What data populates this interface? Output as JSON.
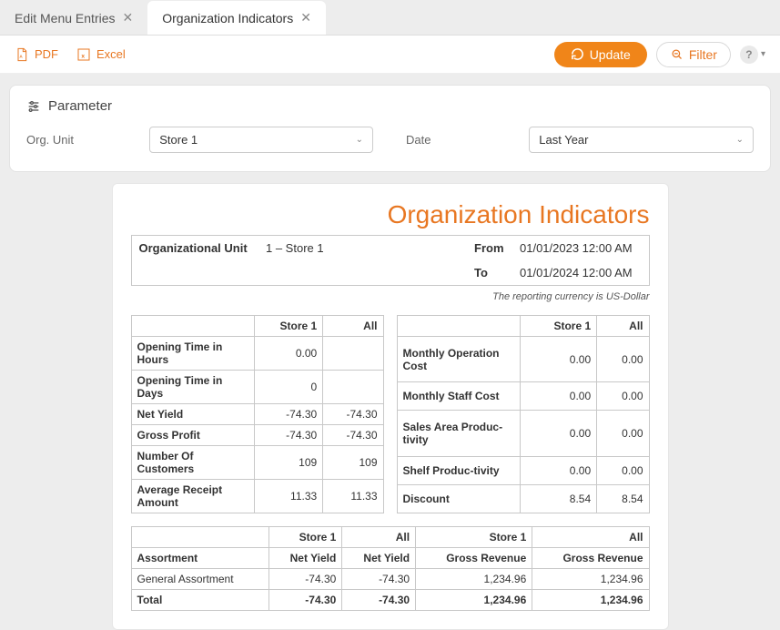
{
  "tabs": [
    {
      "label": "Edit Menu Entries",
      "active": false
    },
    {
      "label": "Organization Indicators",
      "active": true
    }
  ],
  "toolbar": {
    "pdf": "PDF",
    "excel": "Excel",
    "update": "Update",
    "filter": "Filter"
  },
  "parameter": {
    "heading": "Parameter",
    "orgunit_label": "Org. Unit",
    "orgunit_value": "Store 1",
    "date_label": "Date",
    "date_value": "Last Year"
  },
  "report": {
    "title": "Organization Indicators",
    "orgunit_label": "Organizational Unit",
    "orgunit_value": "1 – Store 1",
    "from_label": "From",
    "from_value": "01/01/2023 12:00 AM",
    "to_label": "To",
    "to_value": "01/01/2024 12:00 AM",
    "currency_note": "The reporting currency is US-Dollar",
    "col_store": "Store 1",
    "col_all": "All",
    "left_rows": [
      {
        "label": "Opening Time in Hours",
        "store": "0.00",
        "all": ""
      },
      {
        "label": "Opening Time in Days",
        "store": "0",
        "all": ""
      },
      {
        "label": "Net Yield",
        "store": "-74.30",
        "all": "-74.30"
      },
      {
        "label": "Gross Profit",
        "store": "-74.30",
        "all": "-74.30"
      },
      {
        "label": "Number Of Customers",
        "store": "109",
        "all": "109"
      },
      {
        "label": "Average Receipt Amount",
        "store": "11.33",
        "all": "11.33"
      }
    ],
    "right_rows": [
      {
        "label": "Monthly Operation Cost",
        "store": "0.00",
        "all": "0.00"
      },
      {
        "label": "Monthly Staff Cost",
        "store": "0.00",
        "all": "0.00"
      },
      {
        "label": "Sales Area Produc-tivity",
        "store": "0.00",
        "all": "0.00"
      },
      {
        "label": "Shelf Produc-tivity",
        "store": "0.00",
        "all": "0.00"
      },
      {
        "label": "Discount",
        "store": "8.54",
        "all": "8.54"
      }
    ],
    "wide": {
      "header1": {
        "c1": "Store 1",
        "c2": "All",
        "c3": "Store 1",
        "c4": "All"
      },
      "header2": {
        "r": "Assortment",
        "c1": "Net Yield",
        "c2": "Net Yield",
        "c3": "Gross Revenue",
        "c4": "Gross Revenue"
      },
      "rows": [
        {
          "label": "General Assortment",
          "c1": "-74.30",
          "c2": "-74.30",
          "c3": "1,234.96",
          "c4": "1,234.96",
          "bold": false
        },
        {
          "label": "Total",
          "c1": "-74.30",
          "c2": "-74.30",
          "c3": "1,234.96",
          "c4": "1,234.96",
          "bold": true
        }
      ]
    }
  }
}
